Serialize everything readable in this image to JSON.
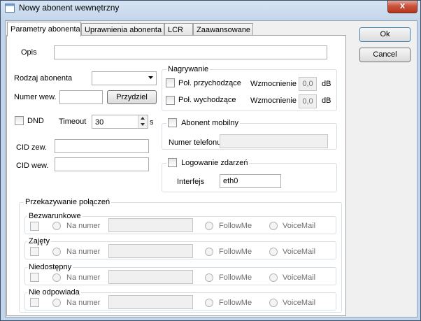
{
  "window": {
    "title": "Nowy abonent wewnętrzny",
    "close_symbol": "x"
  },
  "tabs": [
    {
      "label": "Parametry abonenta"
    },
    {
      "label": "Uprawnienia abonenta"
    },
    {
      "label": "LCR"
    },
    {
      "label": "Zaawansowane"
    }
  ],
  "buttons": {
    "ok": "Ok",
    "cancel": "Cancel",
    "przydziel": "Przydziel"
  },
  "form": {
    "opis_label": "Opis",
    "opis_value": "",
    "rodzaj_label": "Rodzaj abonenta",
    "rodzaj_value": "",
    "numer_label": "Numer wew.",
    "numer_value": "",
    "dnd_label": "DND",
    "timeout_label": "Timeout",
    "timeout_value": "30",
    "timeout_unit": "s",
    "cid_zew_label": "CID zew.",
    "cid_zew_value": "",
    "cid_wew_label": "CID wew.",
    "cid_wew_value": ""
  },
  "recording": {
    "title": "Nagrywanie",
    "incoming_label": "Poł. przychodzące",
    "outgoing_label": "Poł. wychodzące",
    "gain_label": "Wzmocnienie",
    "gain_in": "0,0",
    "gain_out": "0,0",
    "unit": "dB"
  },
  "mobile": {
    "label": "Abonent mobilny",
    "phone_label": "Numer telefonu",
    "phone_value": ""
  },
  "logging": {
    "label": "Logowanie zdarzeń",
    "interface_label": "Interfejs",
    "interface_value": "eth0"
  },
  "forwarding": {
    "title": "Przekazywanie połączeń",
    "number_label": "Na numer",
    "followme_label": "FollowMe",
    "voicemail_label": "VoiceMail",
    "groups": [
      {
        "label": "Bezwarunkowe"
      },
      {
        "label": "Zajęty"
      },
      {
        "label": "Niedostępny"
      },
      {
        "label": "Nie odpowiada"
      }
    ]
  }
}
